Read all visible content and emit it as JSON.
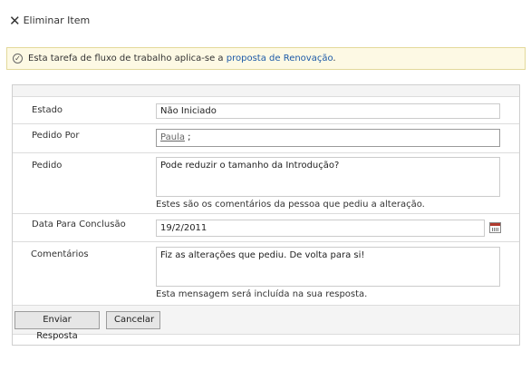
{
  "toolbar": {
    "delete_label": "Eliminar Item"
  },
  "info": {
    "text": "Esta tarefa de fluxo de trabalho aplica-se a ",
    "link": "proposta de Renovação",
    "suffix": "."
  },
  "form": {
    "estado": {
      "label": "Estado",
      "value": "Não Iniciado"
    },
    "pedido_por": {
      "label": "Pedido Por",
      "person": "Paula",
      "separator": " ;"
    },
    "pedido": {
      "label": "Pedido",
      "value": "Pode reduzir o tamanho da Introdução?",
      "hint": "Estes são os comentários da pessoa que pediu a alteração."
    },
    "data": {
      "label": "Data Para Conclusão",
      "value": "19/2/2011"
    },
    "comentarios": {
      "label": "Comentários",
      "value": "Fiz as alterações que pediu. De volta para si!",
      "hint": "Esta mensagem será incluída na sua resposta."
    }
  },
  "buttons": {
    "submit": "Enviar Resposta",
    "cancel": "Cancelar"
  },
  "icons": {
    "delete": "close-icon",
    "info": "check-circle-icon",
    "date": "calendar-icon"
  },
  "colors": {
    "link": "#1d5aa8",
    "info_bg": "#fdf9e4",
    "info_border": "#e3d99a"
  }
}
